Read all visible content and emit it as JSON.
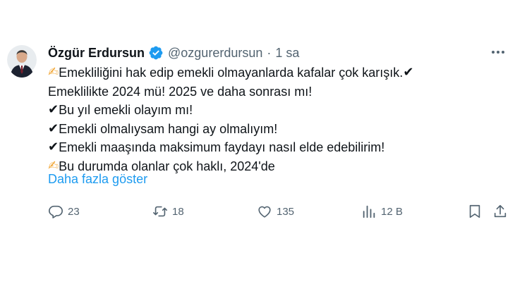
{
  "author": {
    "name": "Özgür Erdursun",
    "handle": "@ozgurerdursun",
    "separator": "·",
    "time": "1 sa"
  },
  "tweet": {
    "line1_text": "Emekliliğini hak edip emekli olmayanlarda kafalar çok karışık.",
    "line2_text": "Emeklilikte 2024 mü! 2025 ve daha sonrası mı!",
    "line3_text": "Bu yıl emekli olayım mı!",
    "line4_text": "Emekli olmalıysam hangi ay olmalıyım!",
    "line5_text": "Emekli maaşında maksimum faydayı nasıl elde edebilirim!",
    "line6_text": "Bu durumda olanlar çok haklı, 2024'de",
    "writing_emoji": "✍",
    "check_emoji": "✔",
    "show_more": "Daha fazla göster"
  },
  "actions": {
    "replies": "23",
    "retweets": "18",
    "likes": "135",
    "views": "12 B"
  },
  "colors": {
    "link": "#1d9bf0",
    "muted": "#536471",
    "verified": "#1d9bf0"
  },
  "icons": {
    "verified": "verified-badge-icon",
    "more": "more-options-icon",
    "reply": "reply-icon",
    "retweet": "retweet-icon",
    "like": "heart-icon",
    "views": "views-icon",
    "bookmark": "bookmark-icon",
    "share": "share-icon"
  }
}
